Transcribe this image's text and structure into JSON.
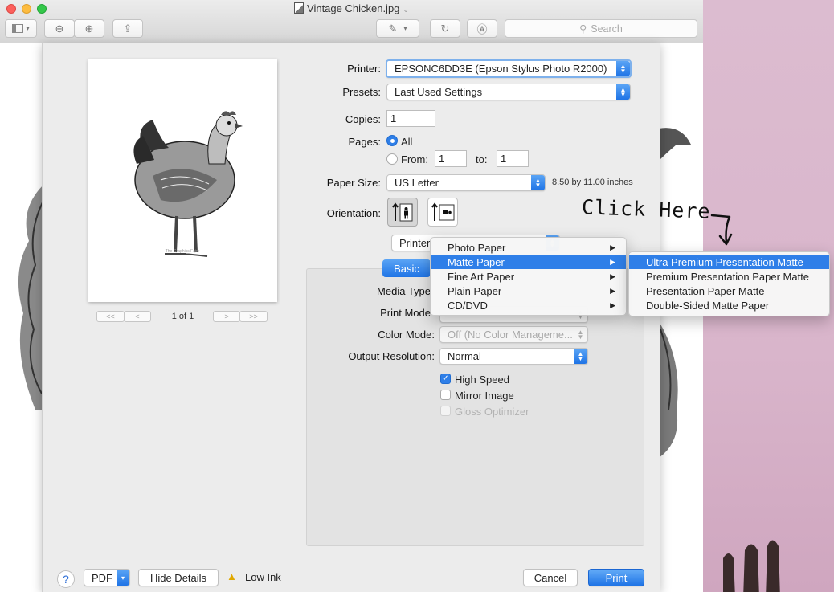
{
  "window": {
    "title": "Vintage Chicken.jpg",
    "search_placeholder": "Search"
  },
  "icons": {
    "title_doc": "image-document-icon",
    "sidebar": "sidebar-icon",
    "zoom_out": "zoom-out-icon",
    "zoom_in": "zoom-in-icon",
    "share": "share-icon",
    "markup": "pen-icon",
    "rotate": "rotate-icon",
    "annotate": "annotate-icon",
    "search": "search-icon",
    "warning": "warning-icon",
    "help": "help-icon"
  },
  "preview": {
    "page_indicator": "1 of 1",
    "caption": "The Graphics Fairy"
  },
  "form": {
    "printer_label": "Printer:",
    "printer_value": "EPSONC6DD3E (Epson Stylus Photo R2000)",
    "presets_label": "Presets:",
    "presets_value": "Last Used Settings",
    "copies_label": "Copies:",
    "copies_value": "1",
    "pages_label": "Pages:",
    "pages_all": "All",
    "pages_from": "From:",
    "pages_from_value": "1",
    "pages_to": "to:",
    "pages_to_value": "1",
    "paper_size_label": "Paper Size:",
    "paper_size_value": "US Letter",
    "paper_size_dims": "8.50 by 11.00 inches",
    "orientation_label": "Orientation:",
    "section_popup": "Printer"
  },
  "settings": {
    "tab_basic": "Basic",
    "media_type_label": "Media Type",
    "print_mode_label": "Print Mode",
    "color_mode_label": "Color Mode:",
    "color_mode_value": "Off (No Color Manageme...",
    "output_res_label": "Output Resolution:",
    "output_res_value": "Normal",
    "high_speed": "High Speed",
    "high_speed_checked": true,
    "mirror_image": "Mirror Image",
    "mirror_image_checked": false,
    "gloss_optimizer": "Gloss Optimizer",
    "gloss_optimizer_checked": false
  },
  "media_menu": {
    "items": [
      {
        "label": "Photo Paper",
        "highlighted": false
      },
      {
        "label": "Matte Paper",
        "highlighted": true
      },
      {
        "label": "Fine Art Paper",
        "highlighted": false
      },
      {
        "label": "Plain Paper",
        "highlighted": false
      },
      {
        "label": "CD/DVD",
        "highlighted": false
      }
    ],
    "submenu_arrow": "▶"
  },
  "matte_submenu": {
    "items": [
      {
        "label": "Ultra Premium Presentation Matte",
        "highlighted": true
      },
      {
        "label": "Premium Presentation Paper Matte",
        "highlighted": false
      },
      {
        "label": "Presentation Paper Matte",
        "highlighted": false
      },
      {
        "label": "Double-Sided Matte Paper",
        "highlighted": false
      }
    ]
  },
  "annotation": {
    "text": "Click Here"
  },
  "footer": {
    "help": "?",
    "pdf": "PDF",
    "hide_details": "Hide Details",
    "low_ink": "Low Ink",
    "cancel": "Cancel",
    "print": "Print"
  },
  "colors": {
    "accent": "#2f7fe8",
    "desktop": "#d9b9cc"
  }
}
